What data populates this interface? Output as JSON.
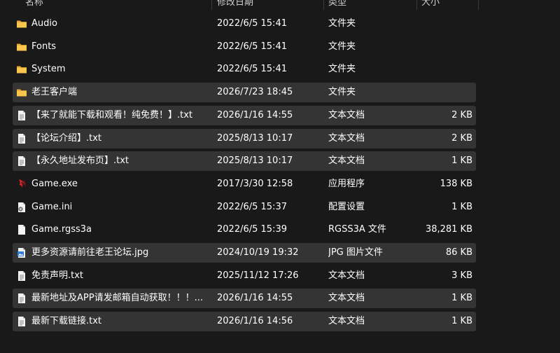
{
  "columns": {
    "name": "名称",
    "date": "修改日期",
    "type": "类型",
    "size": "大小"
  },
  "files": [
    {
      "name": "Audio",
      "date": "2022/6/5 15:41",
      "type": "文件夹",
      "size": "",
      "icon": "folder-icon",
      "selected": false
    },
    {
      "name": "Fonts",
      "date": "2022/6/5 15:41",
      "type": "文件夹",
      "size": "",
      "icon": "folder-icon",
      "selected": false
    },
    {
      "name": "System",
      "date": "2022/6/5 15:41",
      "type": "文件夹",
      "size": "",
      "icon": "folder-icon",
      "selected": false
    },
    {
      "name": "老王客户端",
      "date": "2026/7/23 18:45",
      "type": "文件夹",
      "size": "",
      "icon": "folder-icon",
      "selected": true
    },
    {
      "name": "【来了就能下载和观看！纯免费！】.txt",
      "date": "2026/1/16 14:55",
      "type": "文本文档",
      "size": "2 KB",
      "icon": "text-file-icon",
      "selected": true
    },
    {
      "name": "【论坛介绍】.txt",
      "date": "2025/8/13 10:17",
      "type": "文本文档",
      "size": "2 KB",
      "icon": "text-file-icon",
      "selected": true
    },
    {
      "name": "【永久地址发布页】.txt",
      "date": "2025/8/13 10:17",
      "type": "文本文档",
      "size": "1 KB",
      "icon": "text-file-icon",
      "selected": true
    },
    {
      "name": "Game.exe",
      "date": "2017/3/30 12:58",
      "type": "应用程序",
      "size": "138 KB",
      "icon": "game-exe-icon",
      "selected": false
    },
    {
      "name": "Game.ini",
      "date": "2022/6/5 15:37",
      "type": "配置设置",
      "size": "1 KB",
      "icon": "settings-file-icon",
      "selected": false
    },
    {
      "name": "Game.rgss3a",
      "date": "2022/6/5 15:39",
      "type": "RGSS3A 文件",
      "size": "38,281 KB",
      "icon": "blank-file-icon",
      "selected": false
    },
    {
      "name": "更多资源请前往老王论坛.jpg",
      "date": "2024/10/19 19:32",
      "type": "JPG 图片文件",
      "size": "86 KB",
      "icon": "image-file-icon",
      "selected": true
    },
    {
      "name": "免责声明.txt",
      "date": "2025/11/12 17:26",
      "type": "文本文档",
      "size": "3 KB",
      "icon": "text-file-icon",
      "selected": false
    },
    {
      "name": "最新地址及APP请发邮箱自动获取！！！...",
      "date": "2026/1/16 14:55",
      "type": "文本文档",
      "size": "1 KB",
      "icon": "text-file-icon",
      "selected": true
    },
    {
      "name": "最新下载链接.txt",
      "date": "2026/1/16 14:56",
      "type": "文本文档",
      "size": "1 KB",
      "icon": "text-file-icon",
      "selected": true
    }
  ]
}
